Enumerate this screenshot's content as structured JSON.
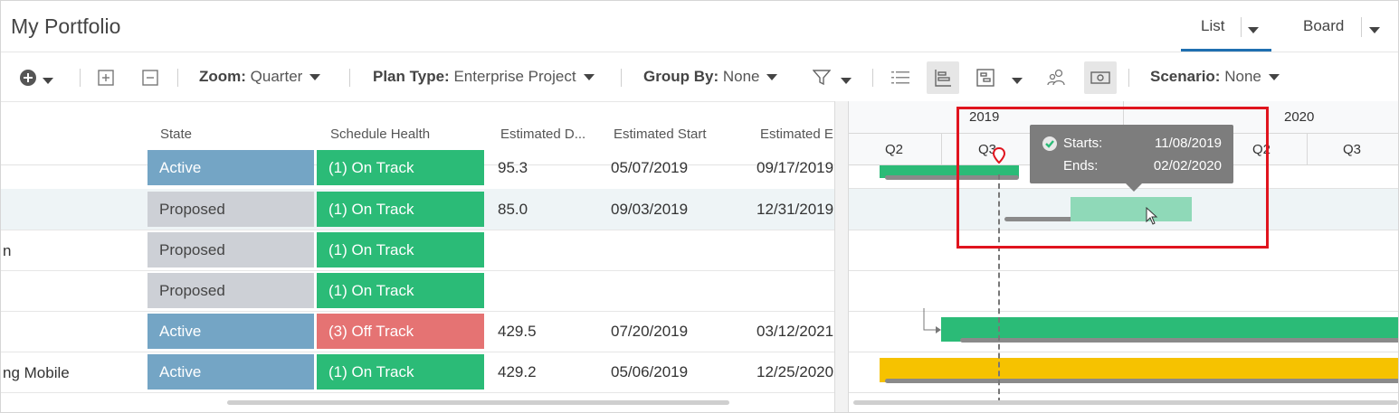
{
  "header": {
    "title": "My Portfolio",
    "tabs": [
      {
        "label": "List",
        "active": true
      },
      {
        "label": "Board",
        "active": false
      }
    ]
  },
  "toolbar": {
    "zoom": {
      "label": "Zoom:",
      "value": "Quarter"
    },
    "plan_type": {
      "label": "Plan Type:",
      "value": "Enterprise Project"
    },
    "group_by": {
      "label": "Group By:",
      "value": "None"
    },
    "scenario": {
      "label": "Scenario:",
      "value": "None"
    }
  },
  "columns": [
    "State",
    "Schedule Health",
    "Estimated D...",
    "Estimated Start",
    "Estimated E"
  ],
  "rows": [
    {
      "name": "",
      "state": "Active",
      "health": "(1) On Track",
      "duration": "95.3",
      "start": "05/07/2019",
      "end": "09/17/2019"
    },
    {
      "name": "",
      "state": "Proposed",
      "health": "(1) On Track",
      "duration": "85.0",
      "start": "09/03/2019",
      "end": "12/31/2019"
    },
    {
      "name": "n",
      "state": "Proposed",
      "health": "(1) On Track",
      "duration": "",
      "start": "",
      "end": ""
    },
    {
      "name": "",
      "state": "Proposed",
      "health": "(1) On Track",
      "duration": "",
      "start": "",
      "end": ""
    },
    {
      "name": "",
      "state": "Active",
      "health": "(3) Off Track",
      "duration": "429.5",
      "start": "07/20/2019",
      "end": "03/12/2021"
    },
    {
      "name": "ng Mobile",
      "state": "Active",
      "health": "(1) On Track",
      "duration": "429.2",
      "start": "05/06/2019",
      "end": "12/25/2020"
    }
  ],
  "gantt": {
    "years": [
      "2019",
      "2020"
    ],
    "quarters": [
      "Q2",
      "Q3",
      "Q2",
      "Q3"
    ]
  },
  "tooltip": {
    "starts_label": "Starts:",
    "starts_value": "11/08/2019",
    "ends_label": "Ends:",
    "ends_value": "02/02/2020"
  },
  "colors": {
    "active": "#74a5c5",
    "proposed": "#cdd0d6",
    "on_track": "#2bbb77",
    "off_track": "#e57373",
    "bar_green": "#2bbb77",
    "bar_light": "#8fd9b8",
    "bar_yellow": "#f6c200",
    "baseline": "#8a8a8a",
    "highlight": "#e0141e"
  }
}
